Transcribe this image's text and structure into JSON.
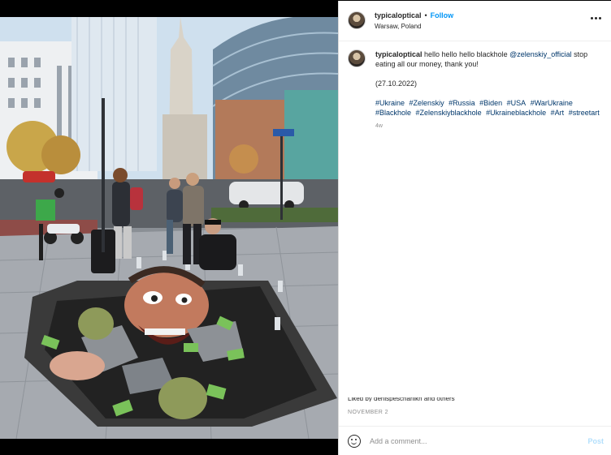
{
  "post": {
    "username": "typicaloptical",
    "follow_label": "Follow",
    "location": "Warsaw, Poland",
    "more_icon": "more-horizontal-icon"
  },
  "caption": {
    "username": "typicaloptical",
    "text_before": "hello hello hello blackhole",
    "mention": "@zelenskiy_official",
    "text_after": "stop eating all our money, thank you!",
    "date": "(27.10.2022)",
    "hashtags": [
      "#Ukraine",
      "#Zelenskiy",
      "#Russia",
      "#Biden",
      "#USA",
      "#WarUkraine",
      "#Blackhole",
      "#Zelenskiyblackhole",
      "#Ukraineblackhole",
      "#Art",
      "#streetart"
    ],
    "age": "4w"
  },
  "liked_by": "Liked by denispeschanikh and others",
  "post_date": "NOVEMBER 2",
  "comment": {
    "placeholder": "Add a comment...",
    "post_label": "Post",
    "emoji_icon": "emoji-icon"
  },
  "colors": {
    "link_blue": "#0095f6",
    "hashtag_blue": "#00376b",
    "post_disabled": "#b2dffc"
  }
}
